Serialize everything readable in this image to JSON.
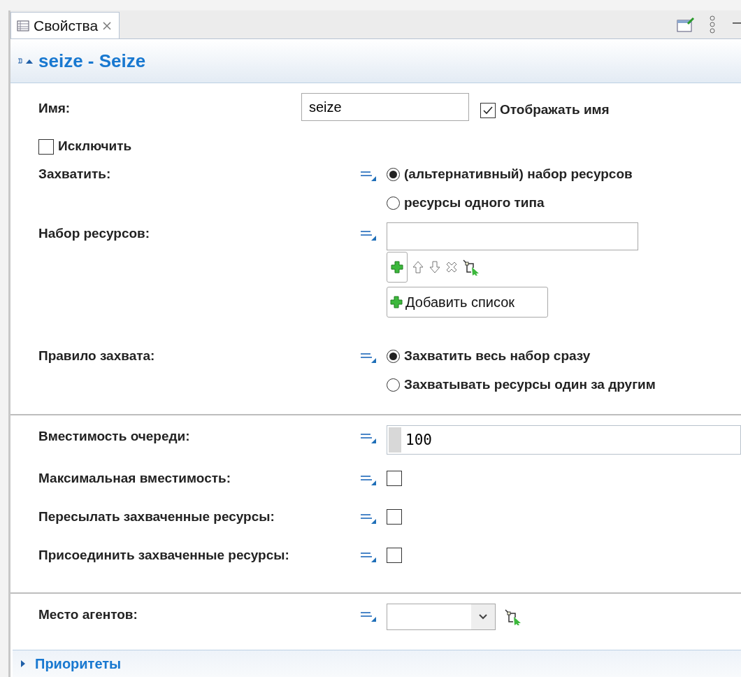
{
  "tabs": [
    {
      "label": "Свойства",
      "selected": true
    }
  ],
  "header": {
    "title": "seize - Seize",
    "expanded": true
  },
  "name_row": {
    "label": "Имя:",
    "value": "seize",
    "show_name": {
      "label": "Отображать имя",
      "checked": true
    }
  },
  "exclude": {
    "label": "Исключить",
    "checked": false
  },
  "sections": [
    [
      {
        "kind": "radio",
        "label": "Захватить:",
        "options": [
          {
            "label": "(альтернативный) набор ресурсов",
            "selected": true
          },
          {
            "label": "ресурсы одного типа",
            "selected": false
          }
        ]
      },
      {
        "kind": "list",
        "label": "Набор ресурсов:",
        "button": "Добавить список"
      },
      {
        "kind": "radio",
        "label": "Правило захвата:",
        "options": [
          {
            "label": "Захватить весь набор сразу",
            "selected": true
          },
          {
            "label": "Захватывать ресурсы один за другим",
            "selected": false
          }
        ]
      }
    ],
    [
      {
        "kind": "number",
        "label": "Вместимость очереди:",
        "value": "100"
      },
      {
        "kind": "checkbox",
        "label": "Максимальная вместимость:",
        "checked": false
      },
      {
        "kind": "checkbox",
        "label": "Пересылать захваченные ресурсы:",
        "checked": false
      },
      {
        "kind": "checkbox",
        "label": "Присоединить захваченные ресурсы:",
        "checked": false
      }
    ],
    [
      {
        "kind": "dropdown",
        "label": "Место агентов:"
      }
    ]
  ],
  "footer": {
    "title": "Приоритеты",
    "expanded": false
  }
}
